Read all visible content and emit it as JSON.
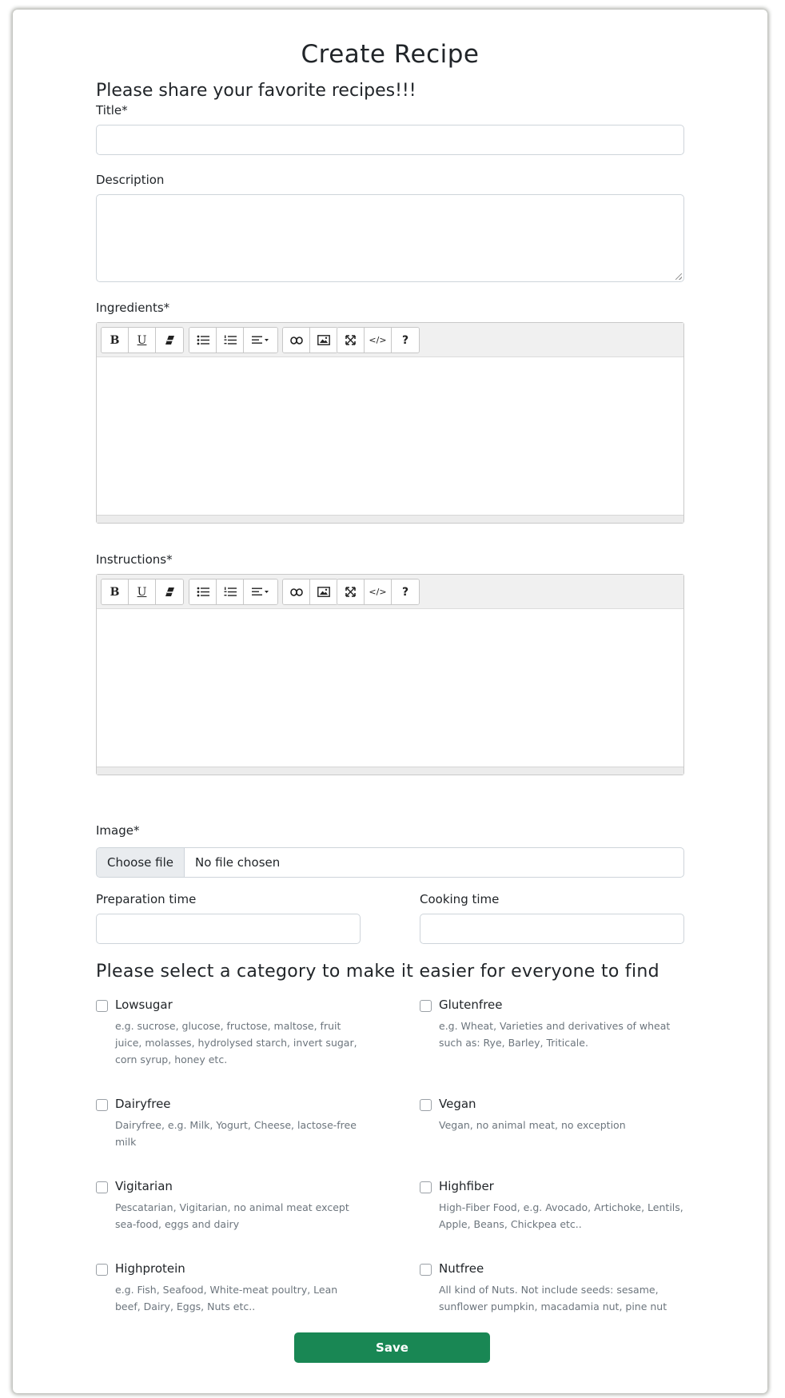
{
  "form": {
    "title": "Create Recipe",
    "subtitle": "Please share your favorite recipes!!!",
    "title_label": "Title*",
    "description_label": "Description",
    "ingredients_label": "Ingredients*",
    "instructions_label": "Instructions*",
    "image_label": "Image*",
    "prep_label": "Preparation time",
    "cook_label": "Cooking time",
    "file_button": "Choose file",
    "file_status": "No file chosen",
    "category_heading": "Please select a category to make it easier for everyone to find",
    "save_label": "Save"
  },
  "toolbar": {
    "bold": "B",
    "underline": "U",
    "help": "?",
    "code": "</>"
  },
  "categories": [
    {
      "name": "Lowsugar",
      "description": "e.g. sucrose, glucose, fructose, maltose, fruit juice, molasses, hydrolysed starch, invert sugar, corn syrup, honey etc."
    },
    {
      "name": "Glutenfree",
      "description": "e.g. Wheat, Varieties and derivatives of wheat such as: Rye, Barley, Triticale."
    },
    {
      "name": "Dairyfree",
      "description": "Dairyfree, e.g. Milk, Yogurt, Cheese, lactose-free milk"
    },
    {
      "name": "Vegan",
      "description": "Vegan, no animal meat, no exception"
    },
    {
      "name": "Vigitarian",
      "description": "Pescatarian, Vigitarian, no animal meat except sea-food, eggs and dairy"
    },
    {
      "name": "Highfiber",
      "description": "High-Fiber Food, e.g. Avocado, Artichoke, Lentils, Apple, Beans, Chickpea etc.."
    },
    {
      "name": "Highprotein",
      "description": "e.g. Fish, Seafood, White-meat poultry, Lean beef, Dairy, Eggs, Nuts etc.."
    },
    {
      "name": "Nutfree",
      "description": "All kind of Nuts. Not include seeds: sesame, sunflower pumpkin, macadamia nut, pine nut"
    }
  ],
  "colors": {
    "primary_button": "#198754",
    "border": "#ced4da",
    "toolbar_bg": "#f0f0f0",
    "muted_text": "#6c757d"
  }
}
